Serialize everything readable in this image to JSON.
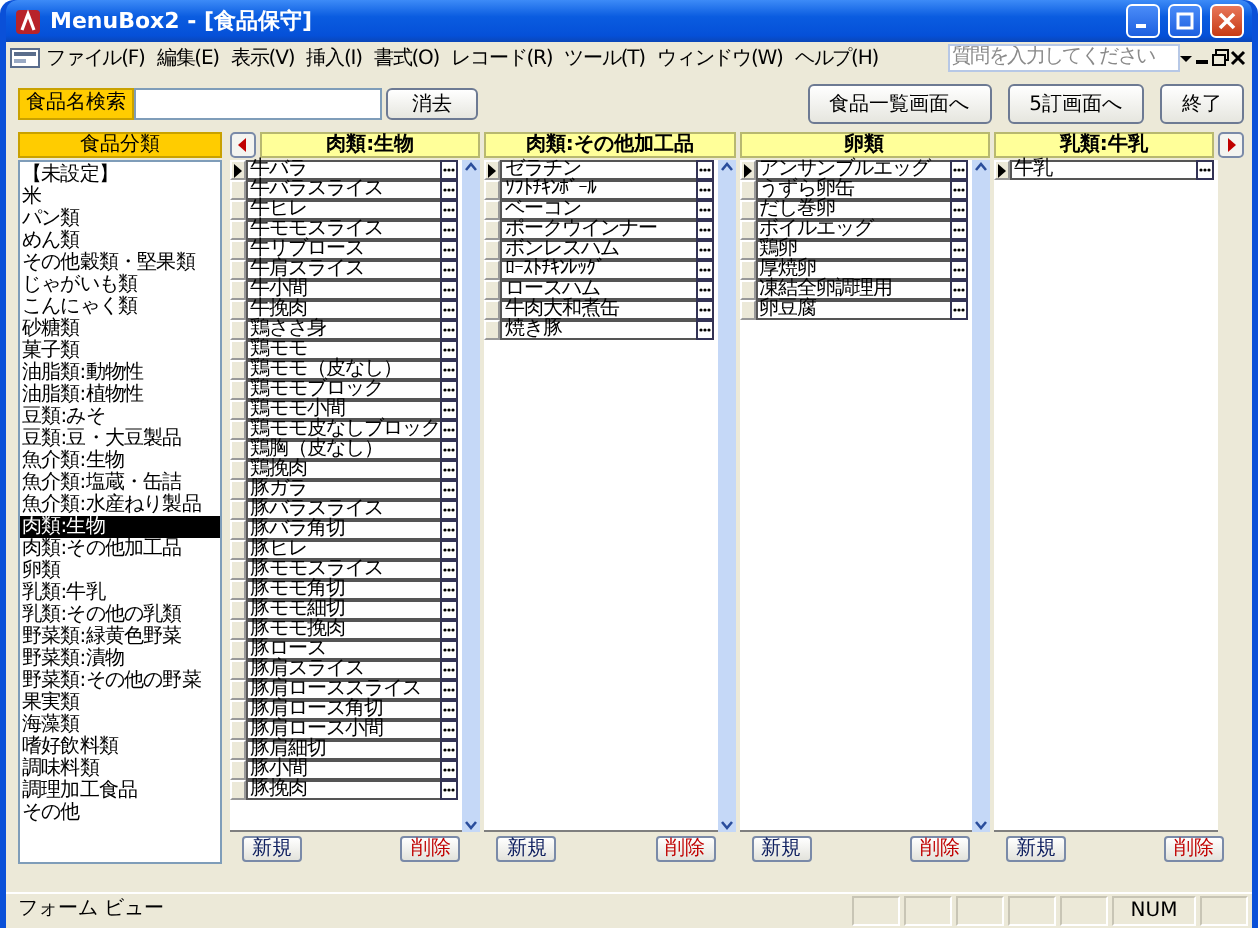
{
  "window": {
    "title": "MenuBox2 - [食品保守]"
  },
  "menu_bar": {
    "items": [
      "ファイル(F)",
      "編集(E)",
      "表示(V)",
      "挿入(I)",
      "書式(O)",
      "レコード(R)",
      "ツール(T)",
      "ウィンドウ(W)",
      "ヘルプ(H)"
    ],
    "help_search": {
      "placeholder": "質問を入力してください"
    }
  },
  "search": {
    "label": "食品名検索",
    "clear_button": "消去"
  },
  "nav_buttons": [
    "食品一覧画面へ",
    "5訂画面へ",
    "終了"
  ],
  "categories": {
    "header": "食品分類",
    "items": [
      {
        "label": "【未設定】",
        "selected": false
      },
      {
        "label": "米",
        "selected": false
      },
      {
        "label": "パン類",
        "selected": false
      },
      {
        "label": "めん類",
        "selected": false
      },
      {
        "label": "その他穀類・堅果類",
        "selected": false
      },
      {
        "label": "じゃがいも類",
        "selected": false
      },
      {
        "label": "こんにゃく類",
        "selected": false
      },
      {
        "label": "砂糖類",
        "selected": false
      },
      {
        "label": "菓子類",
        "selected": false
      },
      {
        "label": "油脂類:動物性",
        "selected": false
      },
      {
        "label": "油脂類:植物性",
        "selected": false
      },
      {
        "label": "豆類:みそ",
        "selected": false
      },
      {
        "label": "豆類:豆・大豆製品",
        "selected": false
      },
      {
        "label": "魚介類:生物",
        "selected": false
      },
      {
        "label": "魚介類:塩蔵・缶詰",
        "selected": false
      },
      {
        "label": "魚介類:水産ねり製品",
        "selected": false
      },
      {
        "label": "肉類:生物",
        "selected": true
      },
      {
        "label": "肉類:その他加工品",
        "selected": false
      },
      {
        "label": "卵類",
        "selected": false
      },
      {
        "label": "乳類:牛乳",
        "selected": false
      },
      {
        "label": "乳類:その他の乳類",
        "selected": false
      },
      {
        "label": "野菜類:緑黄色野菜",
        "selected": false
      },
      {
        "label": "野菜類:漬物",
        "selected": false
      },
      {
        "label": "野菜類:その他の野菜",
        "selected": false
      },
      {
        "label": "果実類",
        "selected": false
      },
      {
        "label": "海藻類",
        "selected": false
      },
      {
        "label": "嗜好飲料類",
        "selected": false
      },
      {
        "label": "調味料類",
        "selected": false
      },
      {
        "label": "調理加工食品",
        "selected": false
      },
      {
        "label": "その他",
        "selected": false
      }
    ]
  },
  "columns": [
    {
      "title": "肉類:生物",
      "new_button": "新規",
      "delete_button": "削除",
      "rows": [
        {
          "label": "牛バラ",
          "current": true
        },
        {
          "label": "牛バラスライス",
          "current": false
        },
        {
          "label": "牛ヒレ",
          "current": false
        },
        {
          "label": "牛モモスライス",
          "current": false
        },
        {
          "label": "牛リブロース",
          "current": false
        },
        {
          "label": "牛肩スライス",
          "current": false
        },
        {
          "label": "牛小間",
          "current": false
        },
        {
          "label": "牛挽肉",
          "current": false
        },
        {
          "label": "鶏ささ身",
          "current": false
        },
        {
          "label": "鶏モモ",
          "current": false
        },
        {
          "label": "鶏モモ（皮なし）",
          "current": false
        },
        {
          "label": "鶏モモブロック",
          "current": false
        },
        {
          "label": "鶏モモ小間",
          "current": false
        },
        {
          "label": "鶏モモ皮なしブロック",
          "current": false
        },
        {
          "label": "鶏胸（皮なし）",
          "current": false
        },
        {
          "label": "鶏挽肉",
          "current": false
        },
        {
          "label": "豚ガラ",
          "current": false
        },
        {
          "label": "豚バラスライス",
          "current": false
        },
        {
          "label": "豚バラ角切",
          "current": false
        },
        {
          "label": "豚ヒレ",
          "current": false
        },
        {
          "label": "豚モモスライス",
          "current": false
        },
        {
          "label": "豚モモ角切",
          "current": false
        },
        {
          "label": "豚モモ細切",
          "current": false
        },
        {
          "label": "豚モモ挽肉",
          "current": false
        },
        {
          "label": "豚ロース",
          "current": false
        },
        {
          "label": "豚肩スライス",
          "current": false
        },
        {
          "label": "豚肩ローススライス",
          "current": false
        },
        {
          "label": "豚肩ロース角切",
          "current": false
        },
        {
          "label": "豚肩ロース小間",
          "current": false
        },
        {
          "label": "豚肩細切",
          "current": false
        },
        {
          "label": "豚小間",
          "current": false
        },
        {
          "label": "豚挽肉",
          "current": false
        }
      ]
    },
    {
      "title": "肉類:その他加工品",
      "new_button": "新規",
      "delete_button": "削除",
      "rows": [
        {
          "label": "ゼラチン",
          "current": true
        },
        {
          "label": "ｿﾌﾄﾁｷﾝﾎﾞｰﾙ",
          "current": false
        },
        {
          "label": "ベーコン",
          "current": false
        },
        {
          "label": "ポークウインナー",
          "current": false
        },
        {
          "label": "ボンレスハム",
          "current": false
        },
        {
          "label": "ﾛｰｽﾄﾁｷﾝﾚｯｸﾞ",
          "current": false
        },
        {
          "label": "ロースハム",
          "current": false
        },
        {
          "label": "牛肉大和煮缶",
          "current": false
        },
        {
          "label": "焼き豚",
          "current": false
        }
      ]
    },
    {
      "title": "卵類",
      "new_button": "新規",
      "delete_button": "削除",
      "rows": [
        {
          "label": "アンサンブルエッグ",
          "current": true
        },
        {
          "label": "うずら卵缶",
          "current": false
        },
        {
          "label": "だし巻卵",
          "current": false
        },
        {
          "label": "ボイルエッグ",
          "current": false
        },
        {
          "label": "鶏卵",
          "current": false
        },
        {
          "label": "厚焼卵",
          "current": false
        },
        {
          "label": "凍結全卵調理用",
          "current": false
        },
        {
          "label": "卵豆腐",
          "current": false
        }
      ]
    },
    {
      "title": "乳類:牛乳",
      "new_button": "新規",
      "delete_button": "削除",
      "rows": [
        {
          "label": "牛乳",
          "current": true
        }
      ]
    }
  ],
  "status_bar": {
    "text": "フォーム ビュー",
    "indicator": "NUM"
  }
}
